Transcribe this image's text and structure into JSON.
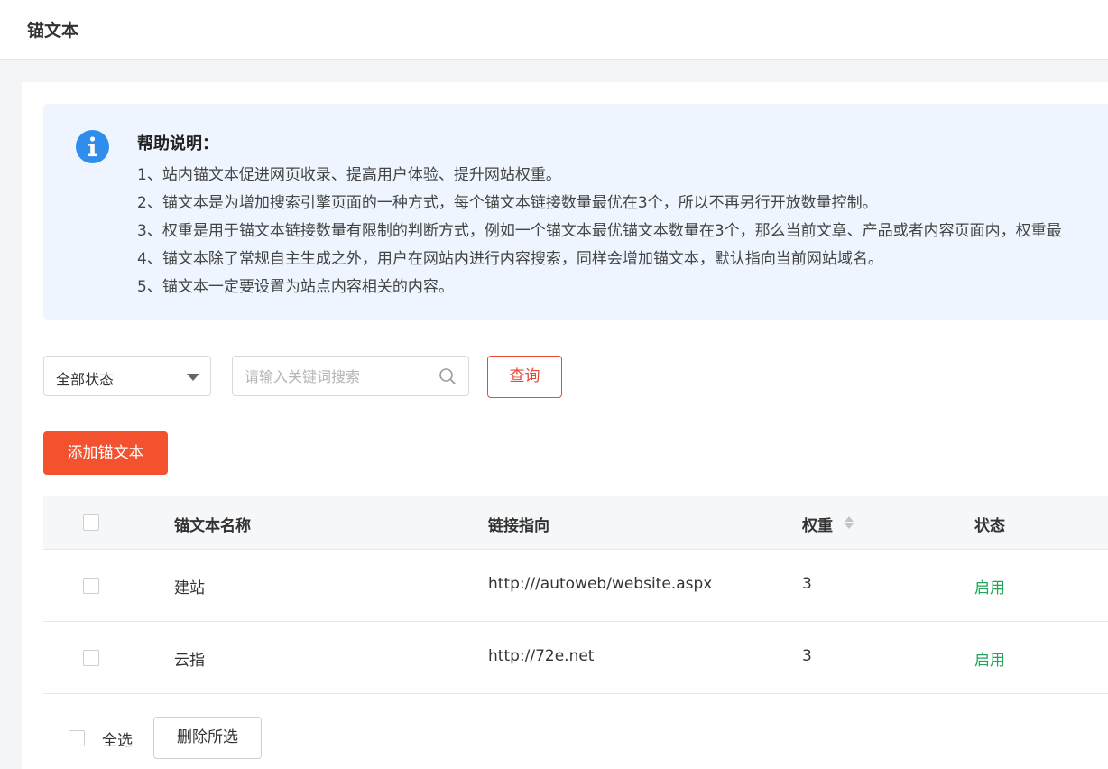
{
  "header": {
    "title": "锚文本"
  },
  "help": {
    "title": "帮助说明：",
    "lines": [
      "1、站内锚文本促进网页收录、提高用户体验、提升网站权重。",
      "2、锚文本是为增加搜索引擎页面的一种方式，每个锚文本链接数量最优在3个，所以不再另行开放数量控制。",
      "3、权重是用于锚文本链接数量有限制的判断方式，例如一个锚文本最优锚文本数量在3个，那么当前文章、产品或者内容页面内，权重最",
      "4、锚文本除了常规自主生成之外，用户在网站内进行内容搜索，同样会增加锚文本，默认指向当前网站域名。",
      "5、锚文本一定要设置为站点内容相关的内容。"
    ]
  },
  "filters": {
    "status_select": "全部状态",
    "search_placeholder": "请输入关键词搜索",
    "query_label": "查询"
  },
  "add_button": "添加锚文本",
  "table": {
    "columns": [
      "锚文本名称",
      "链接指向",
      "权重",
      "状态"
    ],
    "rows": [
      {
        "name": "建站",
        "link": "http:///autoweb/website.aspx",
        "weight": "3",
        "status": "启用"
      },
      {
        "name": "云指",
        "link": "http://72e.net",
        "weight": "3",
        "status": "启用"
      }
    ]
  },
  "footer": {
    "select_all": "全选",
    "delete_selected": "删除所选"
  },
  "colors": {
    "accent": "#f4512f",
    "status_enabled": "#23a55a",
    "info_blue": "#2e8ded"
  }
}
